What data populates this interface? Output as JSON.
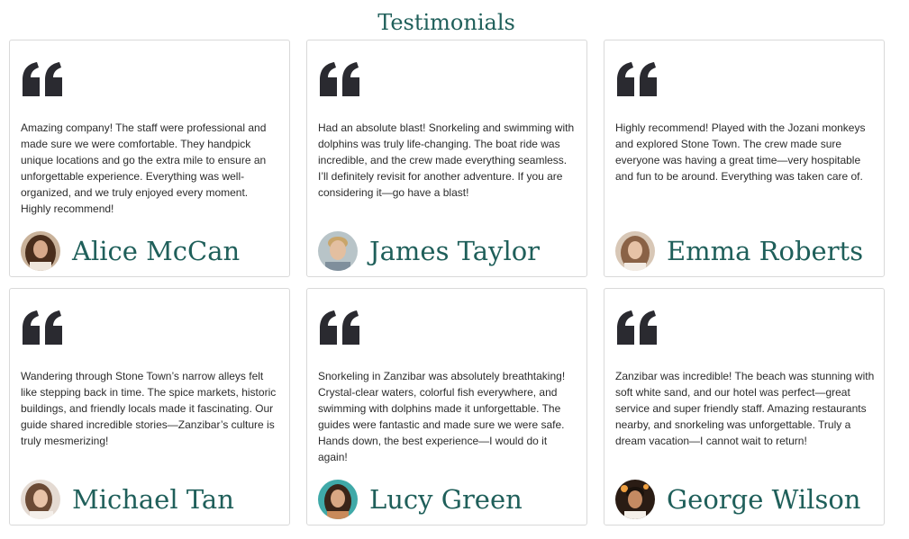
{
  "section": {
    "title": "Testimonials"
  },
  "icons": {
    "quote": "quote-icon",
    "avatar": "avatar-photo"
  },
  "colors": {
    "heading": "#1f5f5a",
    "quote_icon": "#2a2a30",
    "card_border": "#d9d9d9"
  },
  "testimonials": [
    {
      "text": "Amazing company! The staff were professional and made sure we were comfortable. They handpick unique locations and go the extra mile to ensure an unforgettable experience. Everything was well-organized, and we truly enjoyed every moment. Highly recommend!",
      "name": "Alice McCan"
    },
    {
      "text": "Had an absolute blast! Snorkeling and swimming with dolphins was truly life-changing. The boat ride was incredible, and the crew made everything seamless. I’ll definitely revisit for another adventure. If you are considering it—go have a blast!",
      "name": "James Taylor"
    },
    {
      "text": "Highly recommend! Played with the Jozani monkeys and explored Stone Town. The crew made sure everyone was having a great time—very hospitable and fun to be around. Everything was taken care of.",
      "name": "Emma Roberts"
    },
    {
      "text": "Wandering through Stone Town’s narrow alleys felt like stepping back in time. The spice markets, historic buildings, and friendly locals made it fascinating. Our guide shared incredible stories—Zanzibar’s culture is truly mesmerizing!",
      "name": "Michael Tan"
    },
    {
      "text": "Snorkeling in Zanzibar was absolutely breathtaking! Crystal-clear waters, colorful fish everywhere, and swimming with dolphins made it unforgettable. The guides were fantastic and made sure we were safe. Hands down, the best experience—I would do it again!",
      "name": "Lucy Green"
    },
    {
      "text": "Zanzibar was incredible! The beach was stunning with soft white sand, and our hotel was perfect—great service and super friendly staff. Amazing restaurants nearby, and snorkeling was unforgettable. Truly a dream vacation—I cannot wait to return!",
      "name": "George Wilson"
    }
  ]
}
